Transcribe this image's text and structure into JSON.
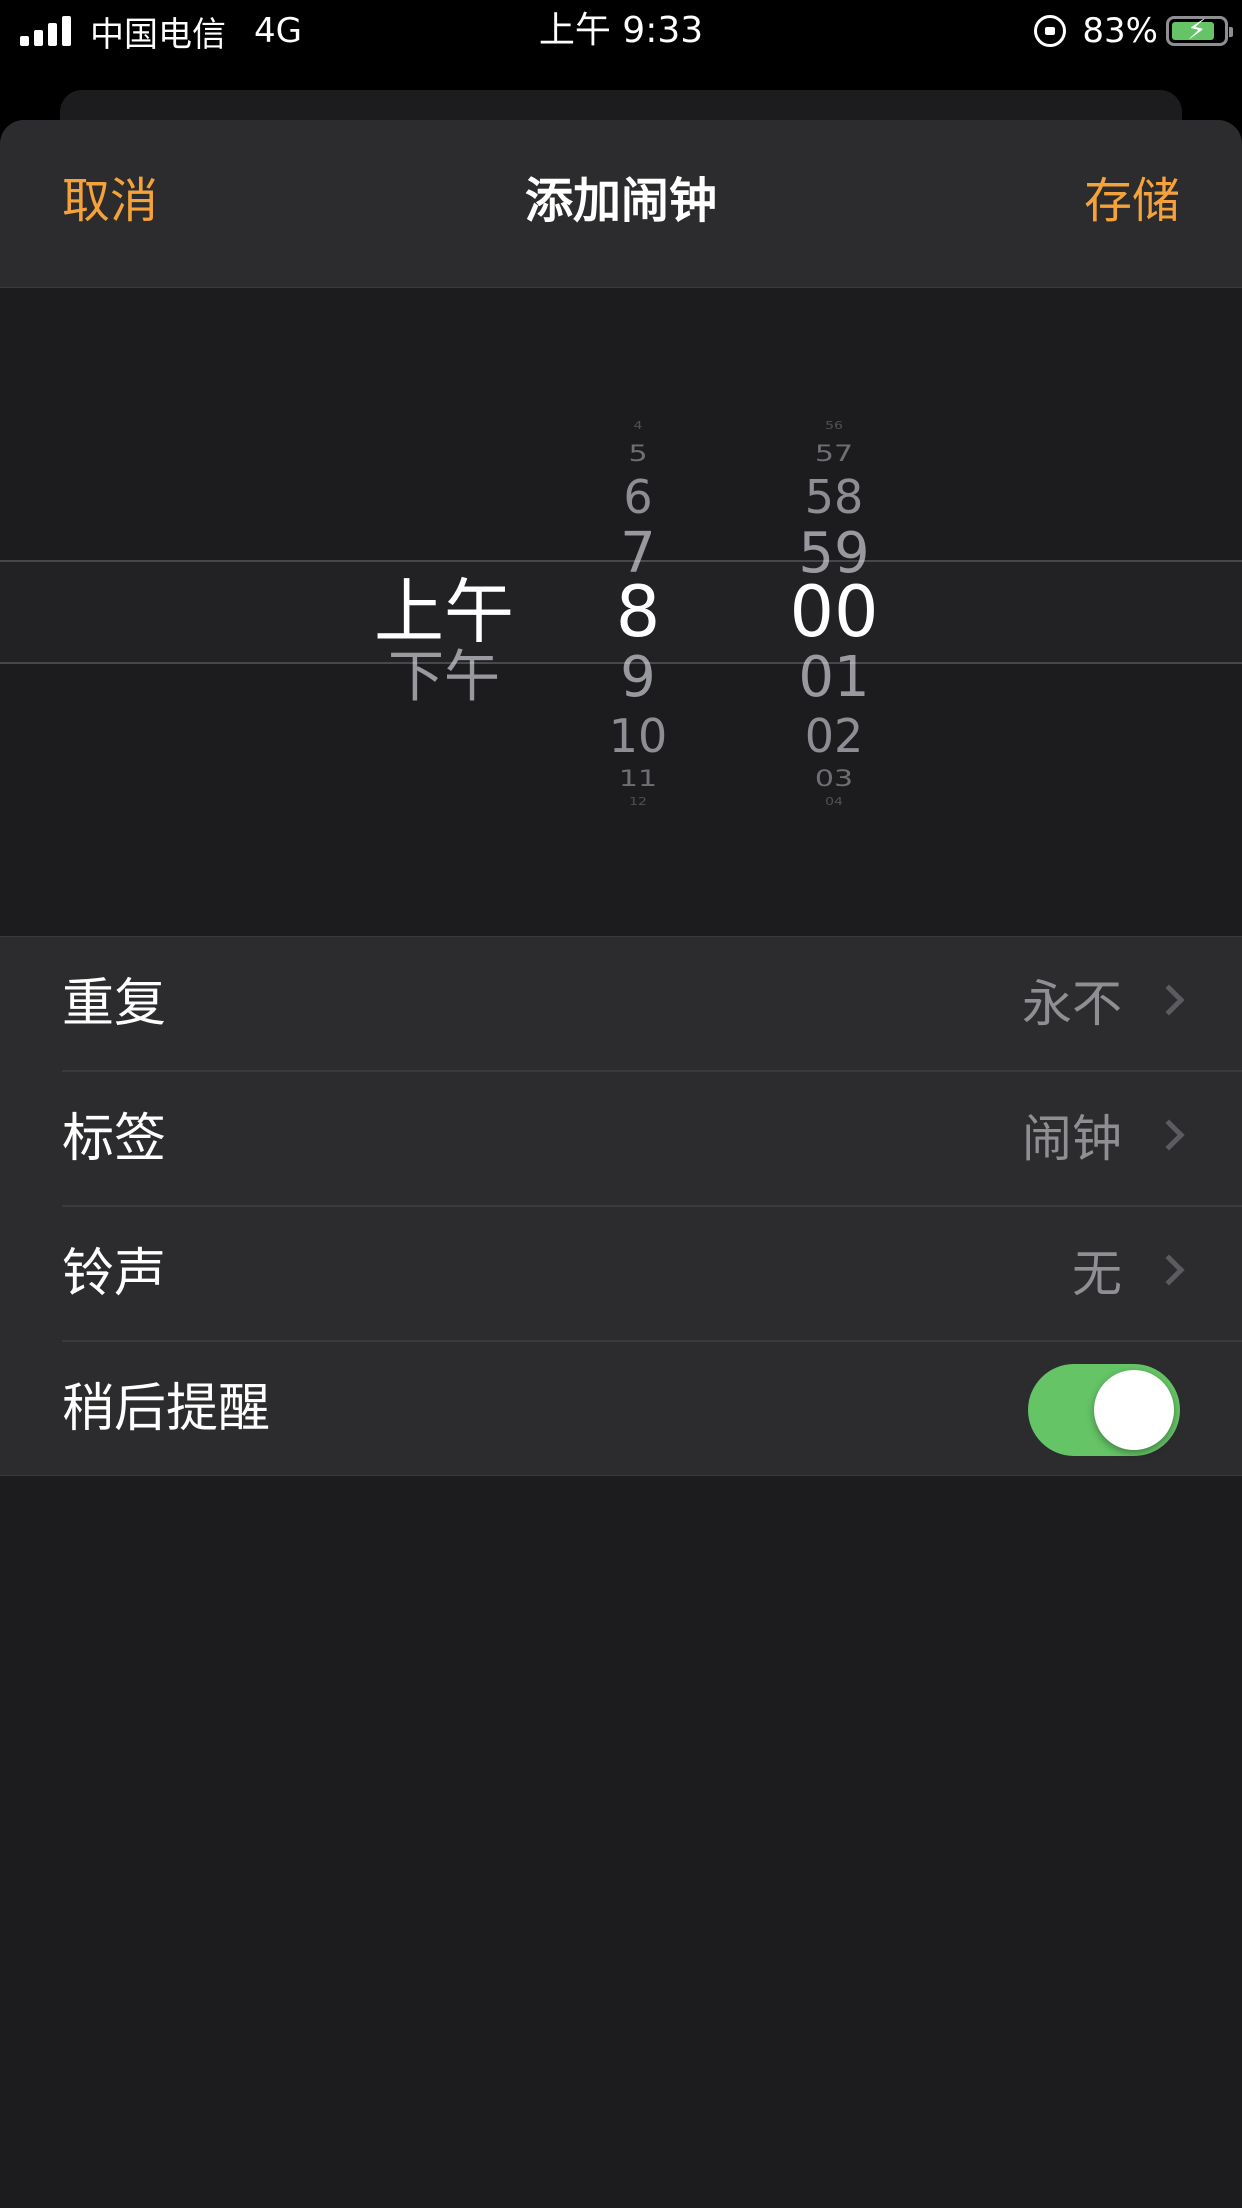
{
  "status_bar": {
    "carrier": "中国电信",
    "network": "4G",
    "time": "上午 9:33",
    "battery": "83%",
    "battery_level": 0.83
  },
  "nav": {
    "cancel_label": "取消",
    "title": "添加闹钟",
    "save_label": "存储"
  },
  "picker": {
    "period_items": [
      "上午",
      "下午"
    ],
    "period_selected": "上午",
    "hour_items": [
      "4",
      "5",
      "6",
      "7",
      "8",
      "9",
      "10",
      "11",
      "12"
    ],
    "hour_selected": "8",
    "minute_items": [
      "56",
      "57",
      "58",
      "59",
      "00",
      "01",
      "02",
      "03",
      "04"
    ],
    "minute_selected": "00"
  },
  "settings": {
    "repeat": {
      "label": "重复",
      "value": "永不"
    },
    "label": {
      "label": "标签",
      "value": "闹钟"
    },
    "sound": {
      "label": "铃声",
      "value": "无"
    },
    "snooze": {
      "label": "稍后提醒",
      "enabled": true
    }
  },
  "colors": {
    "accent": "#f6a23a",
    "toggle_on": "#65c466",
    "background": "#1c1c1e",
    "row_background": "#2c2c2e"
  },
  "icons": [
    "signal-icon",
    "rotation-lock-icon",
    "battery-charging-icon",
    "chevron-right-icon"
  ]
}
